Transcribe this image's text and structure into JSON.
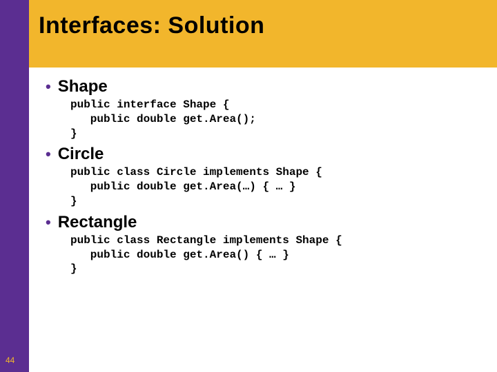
{
  "slide": {
    "title": "Interfaces: Solution",
    "page_number": "44",
    "items": [
      {
        "heading": "Shape",
        "code": "public interface Shape {\n   public double get.Area();\n}"
      },
      {
        "heading": "Circle",
        "code": "public class Circle implements Shape {\n   public double get.Area(…) { … }\n}"
      },
      {
        "heading": "Rectangle",
        "code": "public class Rectangle implements Shape {\n   public double get.Area() { … }\n}"
      }
    ]
  }
}
